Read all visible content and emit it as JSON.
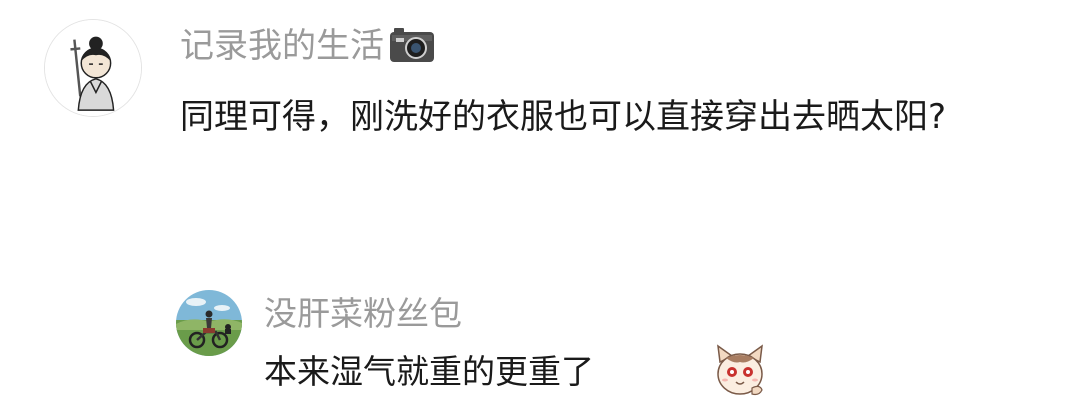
{
  "comments": [
    {
      "username": "记录我的生活",
      "username_badge_icon": "camera-icon",
      "avatar_icon": "cartoon-swordsman-avatar",
      "text": "同理可得，刚洗好的衣服也可以直接穿出去晒太阳?"
    },
    {
      "username": "没肝菜粉丝包",
      "avatar_icon": "motorcycle-rider-avatar",
      "text": "本来湿气就重的更重了",
      "sticker_icon": "cat-face-sticker"
    }
  ],
  "colors": {
    "username": "#9a9a9a",
    "text": "#1a1a1a",
    "background": "#ffffff"
  }
}
